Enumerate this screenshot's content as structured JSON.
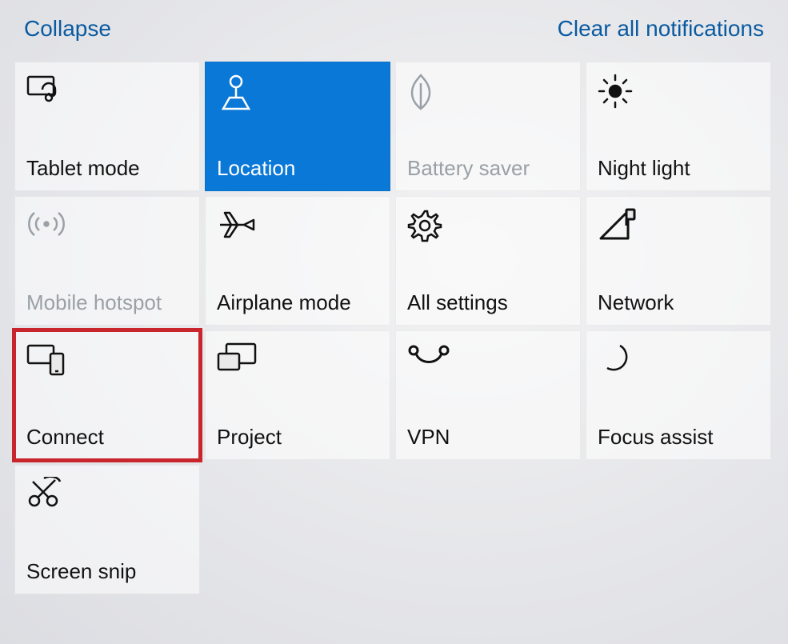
{
  "top": {
    "collapse": "Collapse",
    "clear_all": "Clear all notifications"
  },
  "tiles": [
    {
      "label": "Tablet mode",
      "state": "off",
      "icon": "tablet-mode-icon"
    },
    {
      "label": "Location",
      "state": "on",
      "icon": "location-icon"
    },
    {
      "label": "Battery saver",
      "state": "disabled",
      "icon": "battery-saver-icon"
    },
    {
      "label": "Night light",
      "state": "off",
      "icon": "night-light-icon"
    },
    {
      "label": "Mobile hotspot",
      "state": "disabled",
      "icon": "mobile-hotspot-icon"
    },
    {
      "label": "Airplane mode",
      "state": "off",
      "icon": "airplane-icon"
    },
    {
      "label": "All settings",
      "state": "off",
      "icon": "settings-icon"
    },
    {
      "label": "Network",
      "state": "off",
      "icon": "network-icon"
    },
    {
      "label": "Connect",
      "state": "off",
      "icon": "connect-icon",
      "highlighted": true
    },
    {
      "label": "Project",
      "state": "off",
      "icon": "project-icon"
    },
    {
      "label": "VPN",
      "state": "off",
      "icon": "vpn-icon"
    },
    {
      "label": "Focus assist",
      "state": "off",
      "icon": "focus-assist-icon"
    },
    {
      "label": "Screen snip",
      "state": "off",
      "icon": "screen-snip-icon"
    }
  ],
  "colors": {
    "accent": "#0a78d6",
    "link": "#0a5aa0",
    "highlight_box": "#c9252d",
    "disabled_text": "#9aa0a6"
  }
}
